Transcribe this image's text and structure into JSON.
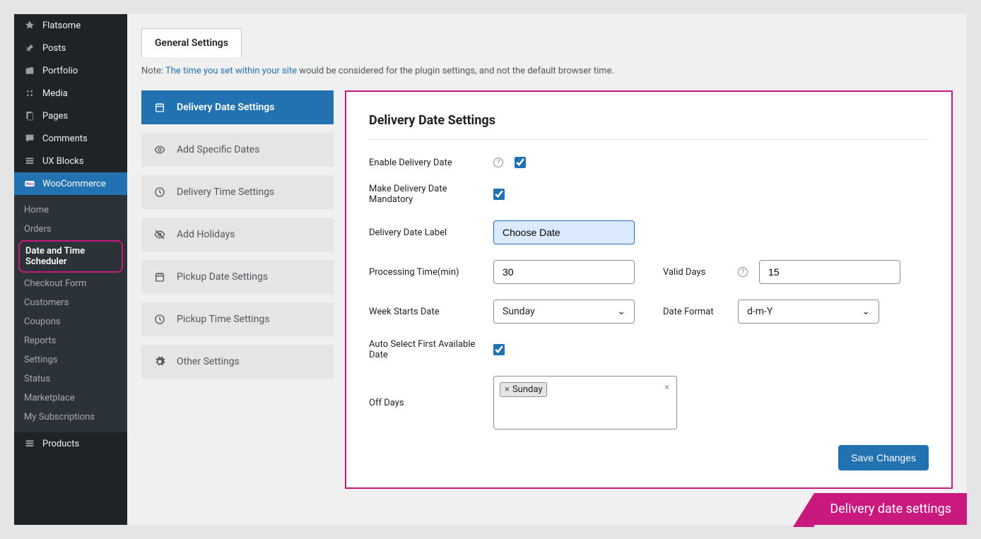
{
  "sidebar": {
    "top": [
      {
        "label": "Flatsome",
        "icon": "flatsome"
      },
      {
        "label": "Posts",
        "icon": "pin"
      },
      {
        "label": "Portfolio",
        "icon": "portfolio"
      },
      {
        "label": "Media",
        "icon": "media"
      },
      {
        "label": "Pages",
        "icon": "page"
      },
      {
        "label": "Comments",
        "icon": "comment"
      },
      {
        "label": "UX Blocks",
        "icon": "block"
      }
    ],
    "wc_label": "WooCommerce",
    "submenu": [
      {
        "label": "Home"
      },
      {
        "label": "Orders"
      },
      {
        "label": "Date and Time Scheduler",
        "highlight": true
      },
      {
        "label": "Checkout Form"
      },
      {
        "label": "Customers"
      },
      {
        "label": "Coupons"
      },
      {
        "label": "Reports"
      },
      {
        "label": "Settings"
      },
      {
        "label": "Status"
      },
      {
        "label": "Marketplace"
      },
      {
        "label": "My Subscriptions"
      }
    ],
    "products_label": "Products"
  },
  "tab_label": "General Settings",
  "note_prefix": "Note: ",
  "note_link": "The time you set within your site",
  "note_suffix": " would be considered for the plugin settings, and not the default browser time.",
  "nav": [
    {
      "label": "Delivery Date Settings",
      "icon": "calendar",
      "active": true
    },
    {
      "label": "Add Specific Dates",
      "icon": "eye"
    },
    {
      "label": "Delivery Time Settings",
      "icon": "clock"
    },
    {
      "label": "Add Holidays",
      "icon": "eye-slash"
    },
    {
      "label": "Pickup Date Settings",
      "icon": "calendar"
    },
    {
      "label": "Pickup Time Settings",
      "icon": "clock"
    },
    {
      "label": "Other Settings",
      "icon": "gear"
    }
  ],
  "panel": {
    "heading": "Delivery Date Settings",
    "enable_label": "Enable Delivery Date",
    "mandatory_label": "Make Delivery Date Mandatory",
    "date_label_label": "Delivery Date Label",
    "date_label_value": "Choose Date",
    "processing_label": "Processing Time(min)",
    "processing_value": "30",
    "valid_days_label": "Valid Days",
    "valid_days_value": "15",
    "week_start_label": "Week Starts Date",
    "week_start_value": "Sunday",
    "date_format_label": "Date Format",
    "date_format_value": "d-m-Y",
    "auto_select_label": "Auto Select First Available Date",
    "off_days_label": "Off Days",
    "off_days_tag": "Sunday",
    "save_label": "Save Changes"
  },
  "caption": "Delivery date settings"
}
